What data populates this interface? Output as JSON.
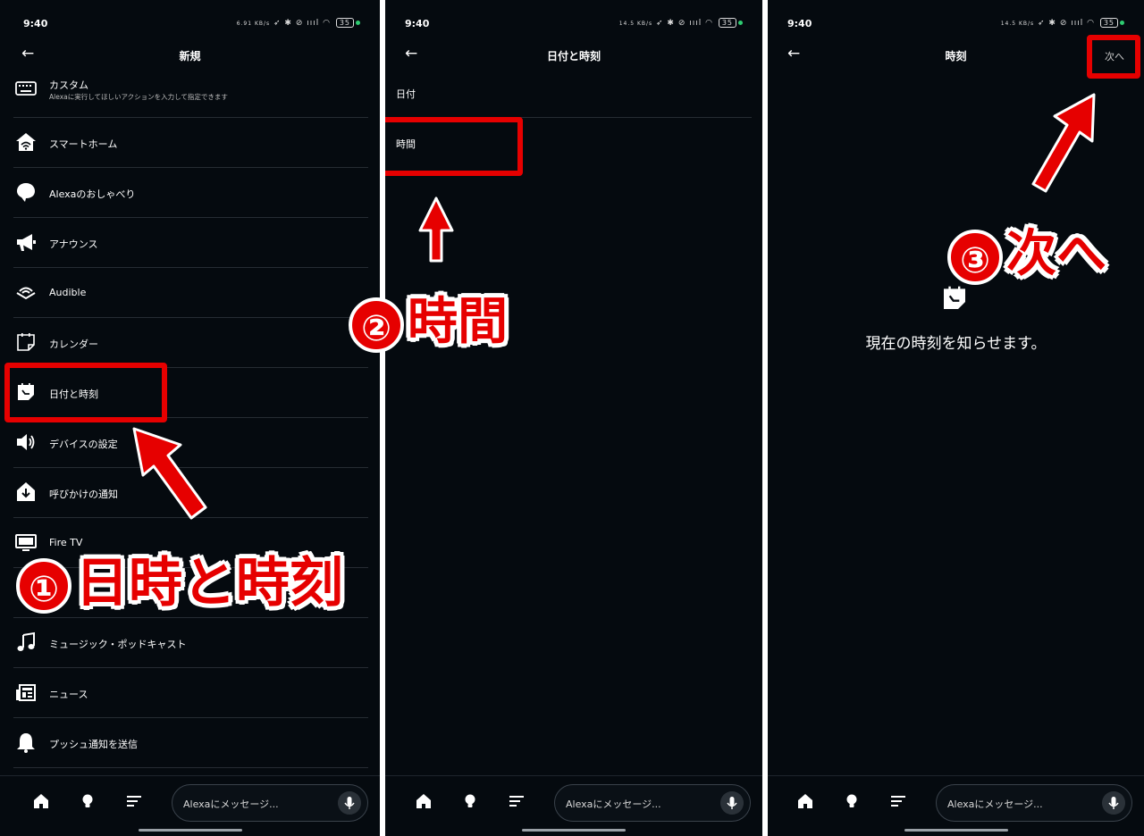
{
  "status_bar": {
    "time": "9:40",
    "icons_left_1": "6.91 KB/s",
    "icons_left_2": "14.5 KB/s",
    "battery": "35"
  },
  "screen1": {
    "title": "新規",
    "items": [
      {
        "label": "カスタム",
        "sub": "Alexaに実行してほしいアクションを入力して指定できます",
        "icon": "keyboard-icon"
      },
      {
        "label": "スマートホーム",
        "icon": "smart-home-icon"
      },
      {
        "label": "Alexaのおしゃべり",
        "icon": "speech-bubble-icon"
      },
      {
        "label": "アナウンス",
        "icon": "megaphone-icon"
      },
      {
        "label": "Audible",
        "icon": "audible-icon"
      },
      {
        "label": "カレンダー",
        "icon": "calendar-icon"
      },
      {
        "label": "日付と時刻",
        "icon": "date-time-icon"
      },
      {
        "label": "デバイスの設定",
        "icon": "speaker-icon"
      },
      {
        "label": "呼びかけの通知",
        "icon": "notification-download-icon"
      },
      {
        "label": "Fire TV",
        "icon": "tv-icon"
      },
      {
        "label": "",
        "icon": "hidden-item-icon"
      },
      {
        "label": "ミュージック・ポッドキャスト",
        "icon": "music-note-icon"
      },
      {
        "label": "ニュース",
        "icon": "news-icon"
      },
      {
        "label": "プッシュ通知を送信",
        "icon": "bell-icon"
      }
    ]
  },
  "screen2": {
    "title": "日付と時刻",
    "items": [
      {
        "label": "日付"
      },
      {
        "label": "時間"
      }
    ]
  },
  "screen3": {
    "title": "時刻",
    "next_label": "次へ",
    "description": "現在の時刻を知らせます。"
  },
  "bottom_bar": {
    "message_placeholder": "Alexaにメッセージ..."
  },
  "annotations": {
    "a1_num": "①",
    "a1_text": "日時と時刻",
    "a2_num": "②",
    "a2_text": "時間",
    "a3_num": "③",
    "a3_text": "次へ"
  },
  "colors": {
    "background": "#050a0f",
    "annotation_red": "#e60000",
    "divider": "#262c33"
  }
}
